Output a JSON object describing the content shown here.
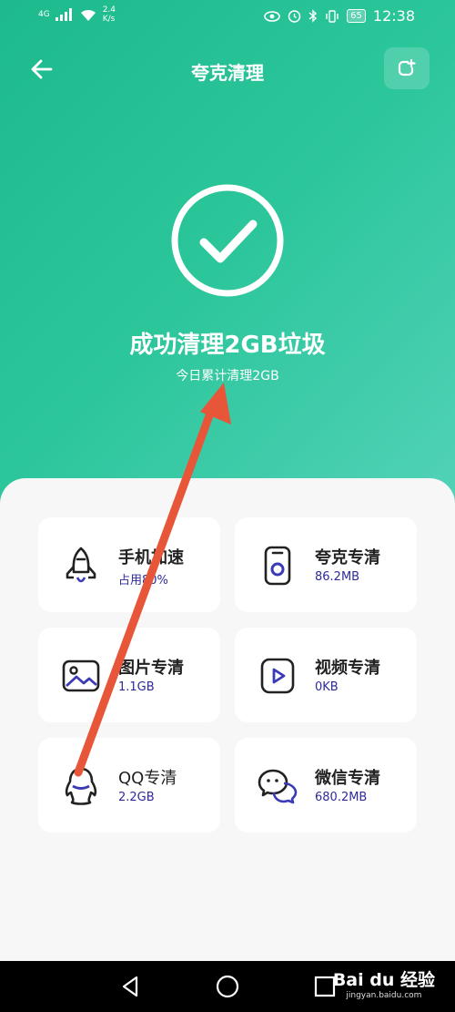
{
  "status_bar": {
    "network_type": "4G",
    "speed_value": "2.4",
    "speed_unit": "K/s",
    "battery": "65",
    "time": "12:38"
  },
  "header": {
    "title": "夸克清理"
  },
  "result": {
    "title": "成功清理2GB垃圾",
    "subtitle": "今日累计清理2GB"
  },
  "cards": [
    {
      "name": "手机加速",
      "value": "占用80%",
      "icon": "rocket-icon"
    },
    {
      "name": "夸克专清",
      "value": "86.2MB",
      "icon": "quark-icon"
    },
    {
      "name": "图片专清",
      "value": "1.1GB",
      "icon": "image-icon"
    },
    {
      "name": "视频专清",
      "value": "0KB",
      "icon": "video-icon"
    },
    {
      "name": "QQ专清",
      "value": "2.2GB",
      "icon": "qq-penguin-icon"
    },
    {
      "name": "微信专清",
      "value": "680.2MB",
      "icon": "wechat-icon"
    }
  ],
  "watermark": {
    "logo": "Bai du 经验",
    "url": "jingyan.baidu.com"
  },
  "colors": {
    "accent": "#1dba8e",
    "icon": "#222222",
    "value_text": "#2e2a9a",
    "annotation_arrow": "#e8563a"
  }
}
